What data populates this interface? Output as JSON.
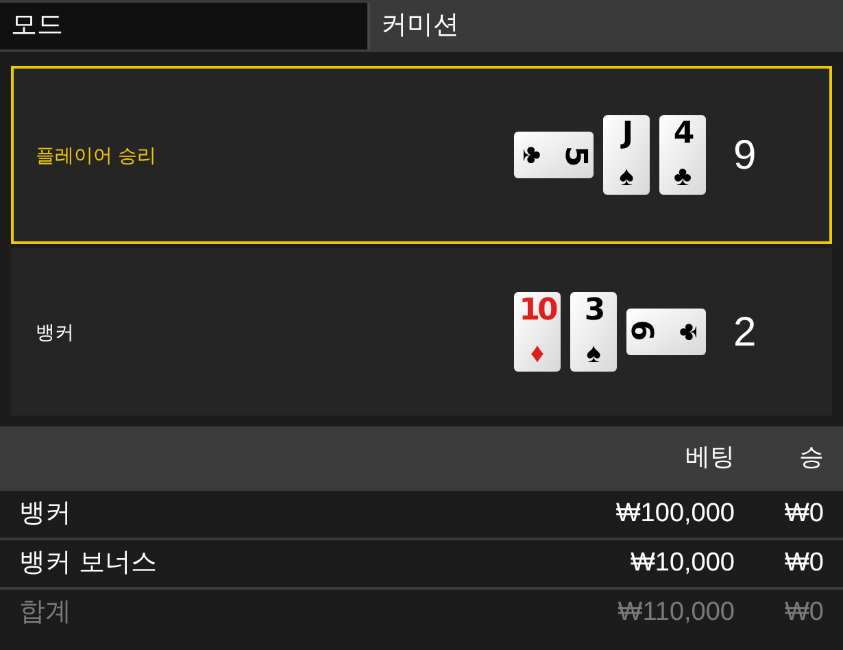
{
  "header": [
    {
      "label": "모드",
      "selected": true
    },
    {
      "label": "커미션",
      "selected": false
    }
  ],
  "hands": [
    {
      "label": "플레이어 승리",
      "winner": true,
      "score": "9",
      "cards": [
        {
          "rank": "5",
          "suit": "♣",
          "color": "#000000",
          "kind": "turned"
        },
        {
          "rank": "J",
          "suit": "♠",
          "color": "#000000",
          "kind": "upright"
        },
        {
          "rank": "4",
          "suit": "♣",
          "color": "#000000",
          "kind": "upright"
        }
      ]
    },
    {
      "label": "뱅커",
      "winner": false,
      "score": "2",
      "cards": [
        {
          "rank": "10",
          "suit": "♦",
          "color": "#e0201c",
          "kind": "upright"
        },
        {
          "rank": "3",
          "suit": "♠",
          "color": "#000000",
          "kind": "upright"
        },
        {
          "rank": "9",
          "suit": "♣",
          "color": "#000000",
          "kind": "counterturned"
        }
      ]
    }
  ],
  "table": {
    "columns": [
      "베팅",
      "승"
    ],
    "rows": [
      {
        "name": "뱅커",
        "bet": "₩100,000",
        "win": "₩0",
        "dimmed": false
      },
      {
        "name": "뱅커 보너스",
        "bet": "₩10,000",
        "win": "₩0",
        "dimmed": false
      },
      {
        "name": "합계",
        "bet": "₩110,000",
        "win": "₩0",
        "dimmed": true
      }
    ]
  }
}
